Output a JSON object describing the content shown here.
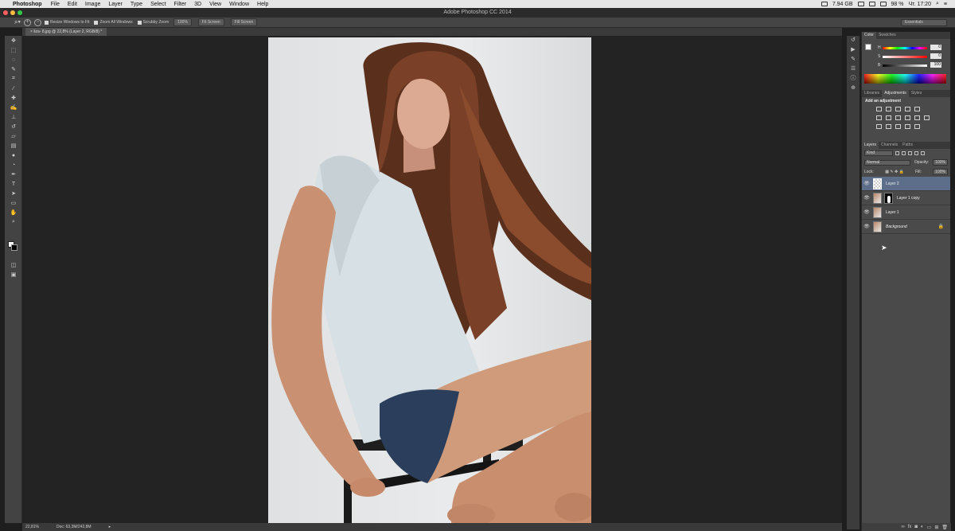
{
  "menubar": {
    "app": "Photoshop",
    "items": [
      "File",
      "Edit",
      "Image",
      "Layer",
      "Type",
      "Select",
      "Filter",
      "3D",
      "View",
      "Window",
      "Help"
    ],
    "memory": "7.94 GB",
    "battery": "98 %",
    "clock": "Чт. 17:20"
  },
  "window": {
    "title": "Adobe Photoshop CC 2014"
  },
  "options": {
    "resize_windows": "Resize Windows to Fit",
    "zoom_all": "Zoom All Windows",
    "scrubby": "Scrubby Zoom",
    "zoom_100": "100%",
    "fit_screen": "Fit Screen",
    "fill_screen": "Fill Screen",
    "workspace": "Essentials"
  },
  "document": {
    "tab_title": "liza- 8.jpg @ 22,8% (Layer 2, RGB/8) *",
    "zoom_status": "22,81%",
    "doc_size": "Doc: 63,3M/242,8M"
  },
  "color_panel": {
    "tabs": [
      "Color",
      "Swatches"
    ],
    "channels": [
      {
        "label": "H",
        "value": "0"
      },
      {
        "label": "S",
        "value": "0"
      },
      {
        "label": "B",
        "value": "100"
      }
    ]
  },
  "adjust_panel": {
    "tabs": [
      "Libraries",
      "Adjustments",
      "Styles"
    ],
    "title": "Add an adjustment"
  },
  "layers_panel": {
    "tabs": [
      "Layers",
      "Channels",
      "Paths"
    ],
    "filter": "Kind",
    "blend_mode": "Normal",
    "opacity_label": "Opacity:",
    "opacity": "100%",
    "lock_label": "Lock:",
    "fill_label": "Fill:",
    "fill": "100%",
    "layers": [
      {
        "name": "Layer 2",
        "selected": true
      },
      {
        "name": "Layer 1 copy",
        "selected": false
      },
      {
        "name": "Layer 1",
        "selected": false
      },
      {
        "name": "Background",
        "selected": false
      }
    ]
  },
  "colors": {
    "selection": "#5c6e8a",
    "panel": "#4a4a4a",
    "canvas_bg": "#232323"
  }
}
